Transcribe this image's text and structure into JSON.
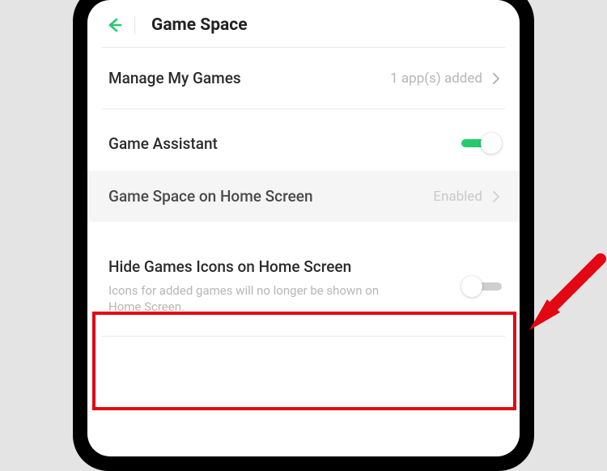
{
  "header": {
    "title": "Game Space"
  },
  "rows": {
    "manage": {
      "label": "Manage My Games",
      "value": "1 app(s) added"
    },
    "assistant": {
      "label": "Game Assistant"
    },
    "homescreen": {
      "label": "Game Space on Home Screen",
      "value": "Enabled"
    },
    "hide": {
      "label": "Hide Games Icons on Home Screen",
      "desc": "Icons for added games will no longer be shown on Home Screen."
    }
  },
  "colors": {
    "accent": "#27c96d",
    "annotation": "#e30613"
  }
}
